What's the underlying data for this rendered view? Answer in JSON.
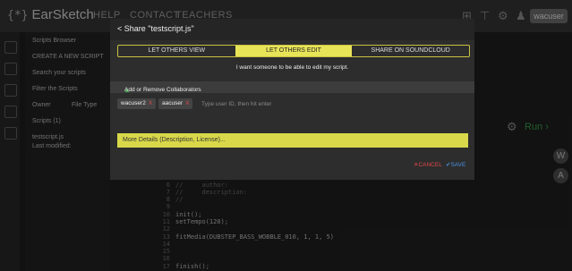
{
  "app": {
    "logo": "EarSketch",
    "nav": [
      "HELP",
      "CONTACT",
      "TEACHERS"
    ],
    "user": "wacuser"
  },
  "browser": {
    "title": "Scripts Browser",
    "create": "CREATE A NEW SCRIPT",
    "search_placeholder": "Search your scripts",
    "filter": "Filter the Scripts",
    "owner": "Owner",
    "filetype": "File Type",
    "scripts_count": "Scripts (1)",
    "script_name": "testscript.js",
    "last_modified": "Last modified:"
  },
  "editor": {
    "run": "Run",
    "lines": [
      {
        "n": "6",
        "t": "//     author:",
        "c": true
      },
      {
        "n": "7",
        "t": "//     description:",
        "c": true
      },
      {
        "n": "8",
        "t": "//",
        "c": true
      },
      {
        "n": "9",
        "t": ""
      },
      {
        "n": "10",
        "t": "init();"
      },
      {
        "n": "11",
        "t": "setTempo(120);"
      },
      {
        "n": "12",
        "t": ""
      },
      {
        "n": "13",
        "t": "fitMedia(DUBSTEP_BASS_WOBBLE_010, 1, 1, 5)"
      },
      {
        "n": "14",
        "t": ""
      },
      {
        "n": "15",
        "t": ""
      },
      {
        "n": "16",
        "t": ""
      },
      {
        "n": "17",
        "t": "finish();"
      }
    ],
    "side_buttons": [
      "W",
      "A"
    ]
  },
  "modal": {
    "title": "Share \"testscript.js\"",
    "tabs": [
      "LET OTHERS VIEW",
      "LET OTHERS EDIT",
      "SHARE ON SOUNDCLOUD"
    ],
    "active_tab": 1,
    "description": "I want someone to be able to edit my script.",
    "collab_header": "Add or Remove Collaborators",
    "collaborators": [
      "wacuser2",
      "aacuser"
    ],
    "input_placeholder": "Type user ID, then hit enter",
    "details": "More Details (Description, License)...",
    "cancel": "CANCEL",
    "save": "SAVE"
  },
  "colors": {
    "accent_yellow": "#e8e458",
    "run_green": "#3ea84f",
    "cancel_red": "#e04848",
    "save_blue": "#4a90e2"
  }
}
